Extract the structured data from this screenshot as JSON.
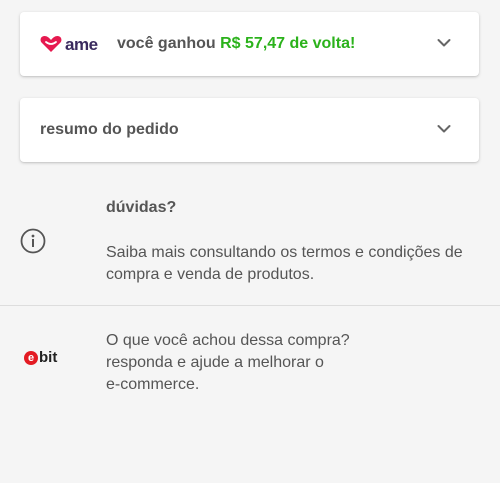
{
  "ame_card": {
    "logo_text": "ame",
    "message_prefix": "você ganhou ",
    "amount": "R$ 57,47 de volta!",
    "brand_color": "#e6194f",
    "amount_color": "#2bb21b"
  },
  "resumo_card": {
    "title": "resumo do pedido"
  },
  "faq": {
    "title": "dúvidas?",
    "body": "Saiba mais consultando os termos e condições de compra e venda de produtos."
  },
  "ebit": {
    "logo_e": "e",
    "logo_text": "bit",
    "line1": "O que você achou dessa compra?",
    "line2": "responda e ajude a melhorar o",
    "line3": "e-commerce.",
    "brand_color": "#e31b23"
  }
}
